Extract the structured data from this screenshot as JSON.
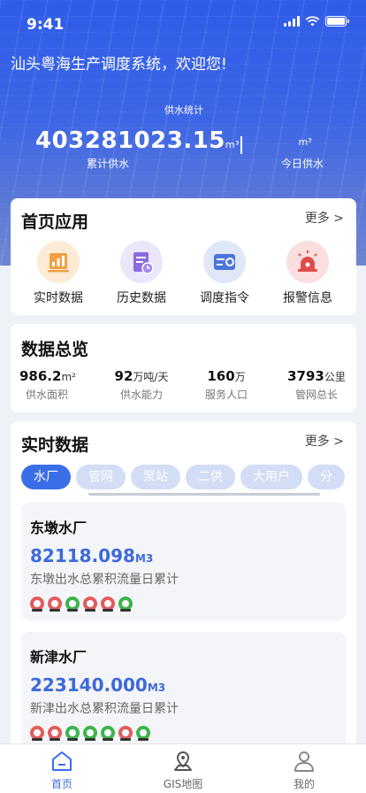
{
  "status_bar": {
    "time": "9:41"
  },
  "header": {
    "welcome": "汕头粤海生产调度系统，欢迎您!",
    "supply_title": "供水统计",
    "total_value": "403281023.15",
    "total_unit": "m³",
    "total_label": "累计供水",
    "today_unit": "m³",
    "today_label": "今日供水"
  },
  "apps": {
    "title": "首页应用",
    "more": "更多 >",
    "items": [
      {
        "label": "实时数据",
        "icon": "bar-chart-icon",
        "color": "#f0a040"
      },
      {
        "label": "历史数据",
        "icon": "history-doc-icon",
        "color": "#8b6be0"
      },
      {
        "label": "调度指令",
        "icon": "dispatch-icon",
        "color": "#4c75d8"
      },
      {
        "label": "报警信息",
        "icon": "alarm-light-icon",
        "color": "#e04c4c"
      }
    ]
  },
  "overview": {
    "title": "数据总览",
    "items": [
      {
        "value": "986.2",
        "unit": "m²",
        "label": "供水面积"
      },
      {
        "value": "92",
        "unit": "万吨/天",
        "label": "供水能力"
      },
      {
        "value": "160",
        "unit": "万",
        "label": "服务人口"
      },
      {
        "value": "3793",
        "unit": "公里",
        "label": "管网总长"
      }
    ]
  },
  "realtime": {
    "title": "实时数据",
    "more": "更多 >",
    "tabs": [
      "水厂",
      "管网",
      "泵站",
      "二供",
      "大用户",
      "分"
    ],
    "active_tab": 0,
    "stations": [
      {
        "name": "东墩水厂",
        "value": "82118.098",
        "unit": "M3",
        "desc": "东墩出水总累积流量日累计",
        "pumps": [
          "red",
          "red",
          "green",
          "red",
          "red",
          "green"
        ]
      },
      {
        "name": "新津水厂",
        "value": "223140.000",
        "unit": "M3",
        "desc": "新津出水总累积流量日累计",
        "pumps": [
          "red",
          "red",
          "green",
          "green",
          "green",
          "red",
          "green"
        ]
      }
    ]
  },
  "tabbar": {
    "items": [
      {
        "label": "首页",
        "icon": "home-icon",
        "active": true
      },
      {
        "label": "GIS地图",
        "icon": "map-pin-icon",
        "active": false
      },
      {
        "label": "我的",
        "icon": "user-icon",
        "active": false
      }
    ]
  },
  "colors": {
    "primary": "#3a6ee8",
    "value_blue": "#3d6ad9",
    "pump_red": "#e25b5b",
    "pump_green": "#3bb54a"
  }
}
